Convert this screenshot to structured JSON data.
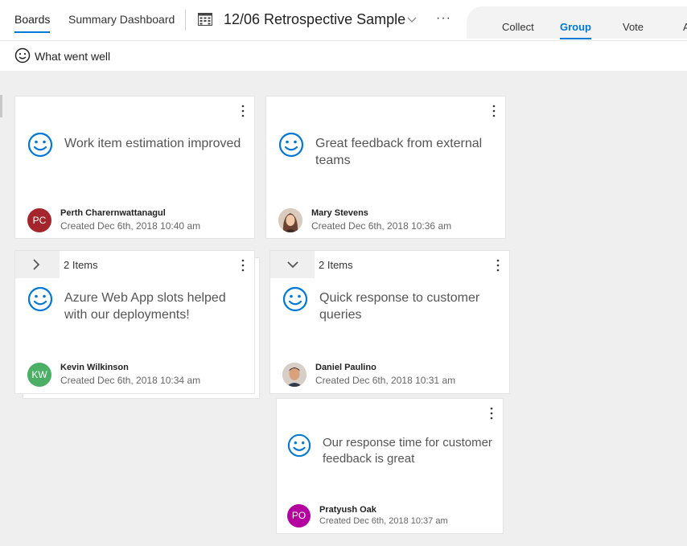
{
  "nav": {
    "boards": "Boards",
    "summary": "Summary Dashboard",
    "board_title": "12/06 Retrospective Sample",
    "more": "···"
  },
  "phases": {
    "collect": "Collect",
    "group": "Group",
    "vote": "Vote",
    "act": "A"
  },
  "column": {
    "title": "What went well"
  },
  "cards": [
    {
      "text": "Work item estimation improved",
      "author": "Perth Charernwattanagul",
      "initials": "PC",
      "avatar_color": "#a4262c",
      "created": "Created Dec 6th, 2018 10:40 am"
    },
    {
      "text": "Great feedback from external teams",
      "author": "Mary Stevens",
      "initials": "",
      "avatar_color": "#8a6a55",
      "created": "Created Dec 6th, 2018 10:36 am"
    },
    {
      "group_count": "2 Items",
      "text": "Azure Web App slots helped with our deployments!",
      "author": "Kevin Wilkinson",
      "initials": "KW",
      "avatar_color": "#4caf66",
      "created": "Created Dec 6th, 2018 10:34 am"
    },
    {
      "group_count": "2 Items",
      "text": "Quick response to customer queries",
      "author": "Daniel Paulino",
      "initials": "",
      "avatar_color": "#6b4b3a",
      "created": "Created Dec 6th, 2018 10:31 am"
    },
    {
      "text": "Our response time for customer feedback is great",
      "author": "Pratyush Oak",
      "initials": "PO",
      "avatar_color": "#b4009e",
      "created": "Created Dec 6th, 2018 10:37 am"
    }
  ]
}
